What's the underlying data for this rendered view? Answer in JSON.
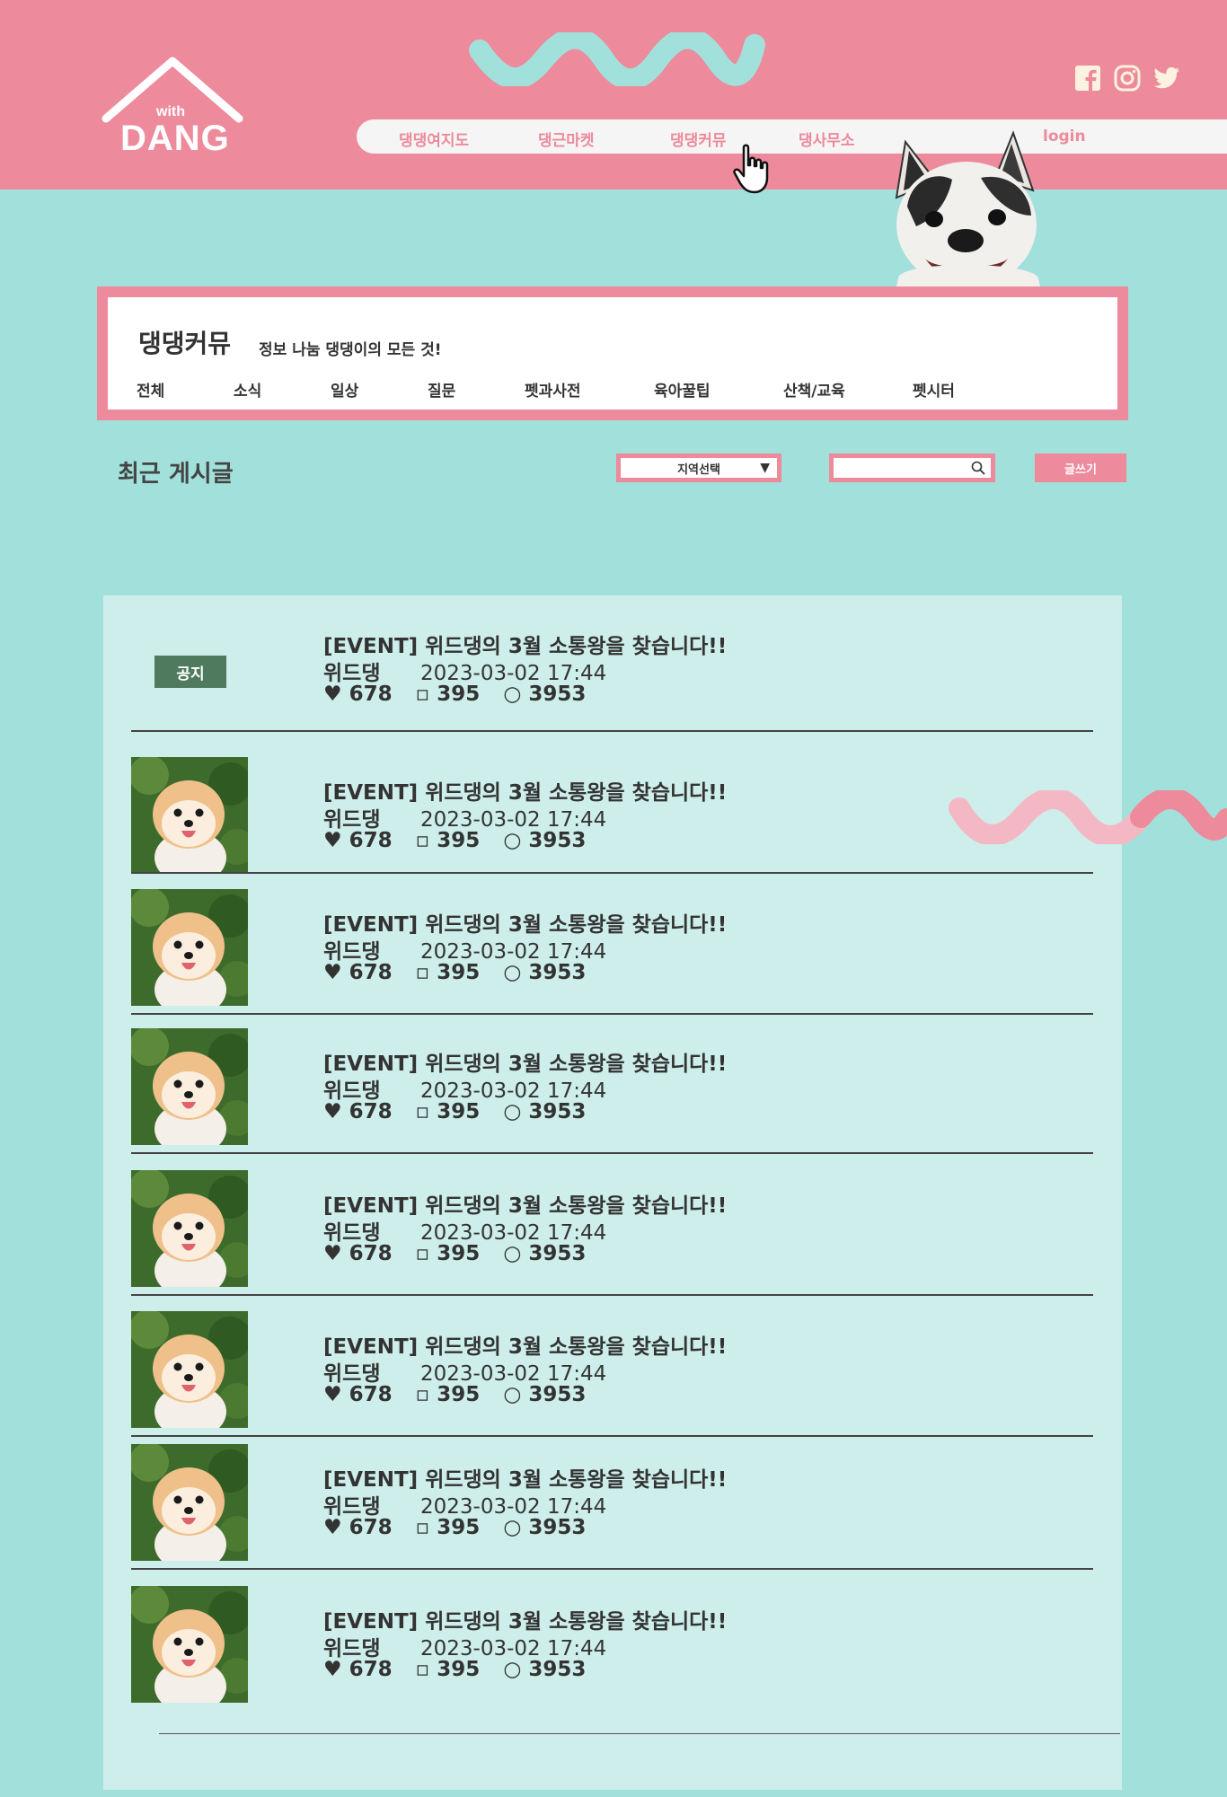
{
  "logo": {
    "with": "with",
    "dang": "DANG"
  },
  "nav": {
    "items": [
      "댕댕여지도",
      "댕근마켓",
      "댕댕커뮤",
      "댕사무소"
    ],
    "login": "login"
  },
  "social": [
    "facebook-icon",
    "instagram-icon",
    "twitter-icon"
  ],
  "community": {
    "title": "댕댕커뮤",
    "subtitle": "정보 나눔 댕댕이의 모든 것!",
    "tabs": [
      "전체",
      "소식",
      "일상",
      "질문",
      "펫과사전",
      "육아꿀팁",
      "산책/교육",
      "펫시터"
    ]
  },
  "recent": {
    "title": "최근 게시글",
    "region_select": "지역선택",
    "search_placeholder": "",
    "write_button": "글쓰기"
  },
  "notice": {
    "badge": "공지",
    "title": "[EVENT] 위드댕의 3월 소통왕을 찾습니다!!",
    "author": "위드댕",
    "datetime": "2023-03-02  17:44",
    "likes": "678",
    "comments": "395",
    "views": "3953"
  },
  "posts": [
    {
      "title": "[EVENT] 위드댕의 3월 소통왕을 찾습니다!!",
      "author": "위드댕",
      "datetime": "2023-03-02  17:44",
      "likes": "678",
      "comments": "395",
      "views": "3953"
    },
    {
      "title": "[EVENT] 위드댕의 3월 소통왕을 찾습니다!!",
      "author": "위드댕",
      "datetime": "2023-03-02  17:44",
      "likes": "678",
      "comments": "395",
      "views": "3953"
    },
    {
      "title": "[EVENT] 위드댕의 3월 소통왕을 찾습니다!!",
      "author": "위드댕",
      "datetime": "2023-03-02  17:44",
      "likes": "678",
      "comments": "395",
      "views": "3953"
    },
    {
      "title": "[EVENT] 위드댕의 3월 소통왕을 찾습니다!!",
      "author": "위드댕",
      "datetime": "2023-03-02  17:44",
      "likes": "678",
      "comments": "395",
      "views": "3953"
    },
    {
      "title": "[EVENT] 위드댕의 3월 소통왕을 찾습니다!!",
      "author": "위드댕",
      "datetime": "2023-03-02  17:44",
      "likes": "678",
      "comments": "395",
      "views": "3953"
    },
    {
      "title": "[EVENT] 위드댕의 3월 소통왕을 찾습니다!!",
      "author": "위드댕",
      "datetime": "2023-03-02  17:44",
      "likes": "678",
      "comments": "395",
      "views": "3953"
    },
    {
      "title": "[EVENT] 위드댕의 3월 소통왕을 찾습니다!!",
      "author": "위드댕",
      "datetime": "2023-03-02  17:44",
      "likes": "678",
      "comments": "395",
      "views": "3953"
    }
  ],
  "stat_icons": {
    "like": "♥",
    "comment": "▫",
    "view": "○"
  },
  "colors": {
    "header_pink": "#ed8a9b",
    "background_mint": "#a2e0db",
    "panel_mint": "#cdeeea",
    "notice_green": "#4f7a5e"
  }
}
